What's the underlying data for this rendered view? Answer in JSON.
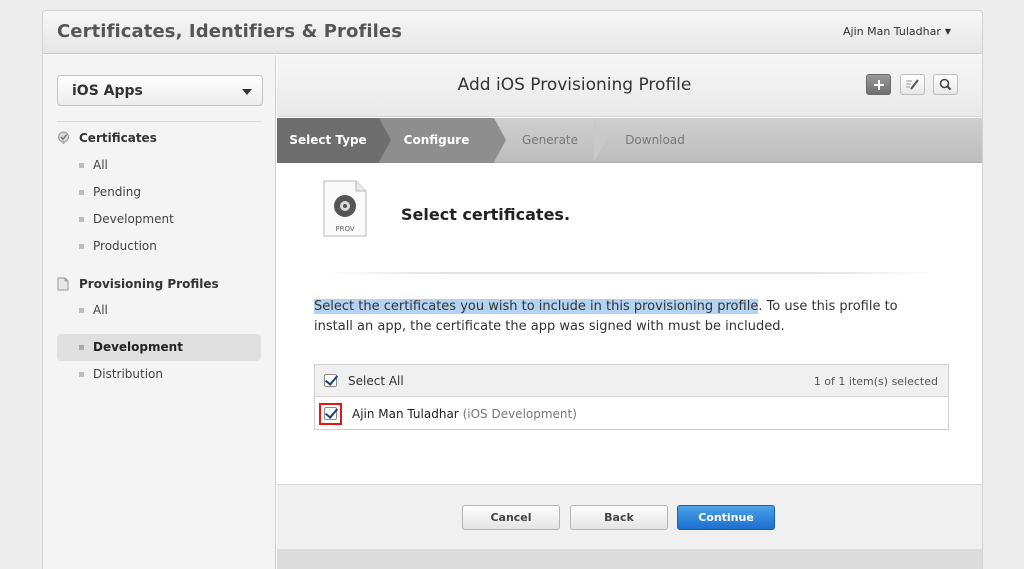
{
  "app": {
    "title": "Certificates, Identifiers & Profiles",
    "user": "Ajin Man Tuladhar"
  },
  "sidebar": {
    "platform_select": "iOS Apps",
    "sections": [
      {
        "label": "Certificates",
        "items": [
          "All",
          "Pending",
          "Development",
          "Production"
        ]
      },
      {
        "label": "Provisioning Profiles",
        "items": [
          "All",
          "Development",
          "Distribution"
        ]
      }
    ],
    "active_item": "Development"
  },
  "main": {
    "title": "Add iOS Provisioning Profile",
    "steps": [
      "Select Type",
      "Configure",
      "Generate",
      "Download"
    ],
    "icon_label": "PROV",
    "section_title": "Select certificates.",
    "description_highlight": "Select the certificates you wish to include in this provisioning profile",
    "description_rest": ". To use this profile to install an app, the certificate the app was signed with must be included.",
    "table": {
      "select_all": "Select All",
      "count": "1 of 1 item(s) selected",
      "rows": [
        {
          "name": "Ajin Man Tuladhar",
          "type": "(iOS Development)"
        }
      ]
    },
    "buttons": {
      "cancel": "Cancel",
      "back": "Back",
      "continue": "Continue"
    }
  },
  "colors": {
    "accent": "#1c6fcf",
    "highlight": "#b4d2f2",
    "callout": "#e21818"
  }
}
